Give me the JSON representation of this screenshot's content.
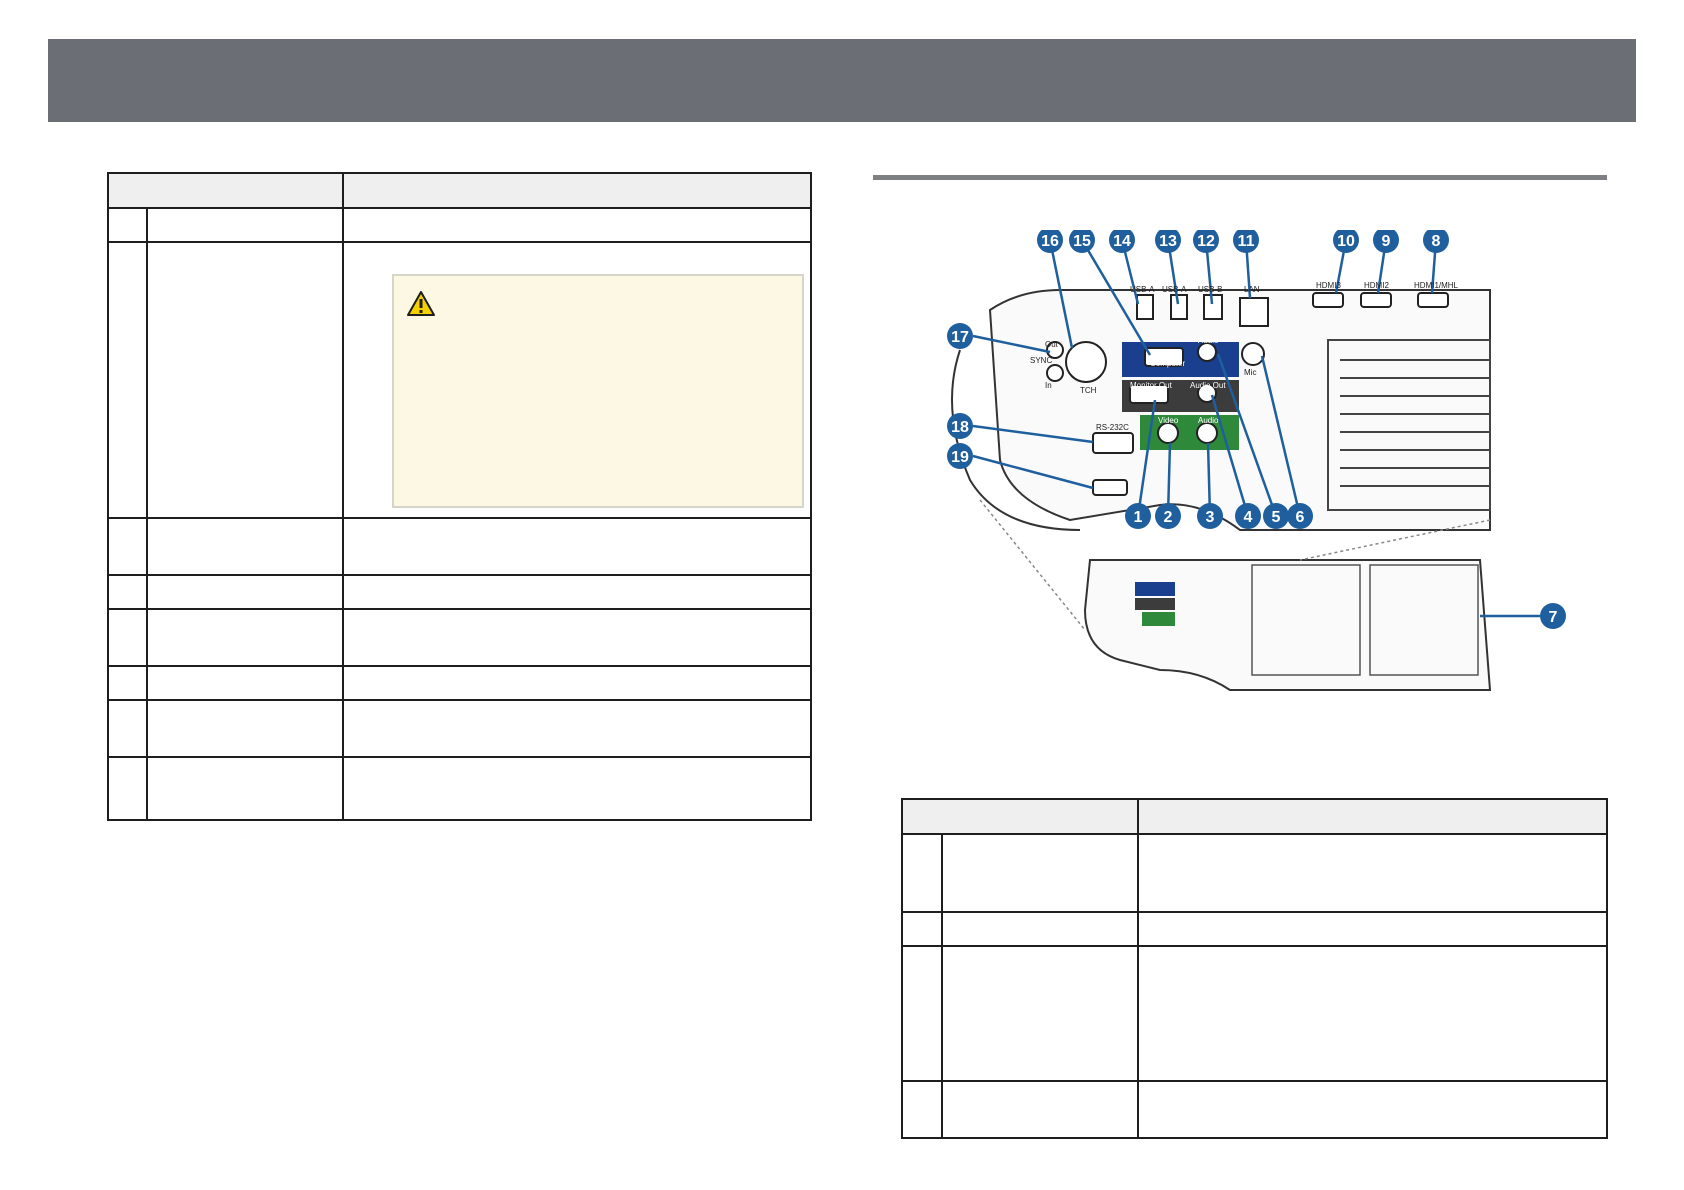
{
  "header": {
    "title": ""
  },
  "left_table": {
    "rows": 8
  },
  "right_table": {
    "rows": 4
  },
  "diagram": {
    "callouts": [
      "1",
      "2",
      "3",
      "4",
      "5",
      "6",
      "7",
      "8",
      "9",
      "10",
      "11",
      "12",
      "13",
      "14",
      "15",
      "16",
      "17",
      "18",
      "19"
    ],
    "port_labels": {
      "usb_a_1": "USB-A",
      "usb_a_2": "USB-A",
      "usb_b": "USB-B",
      "lan": "LAN",
      "hdmi3": "HDMI3",
      "hdmi2": "HDMI2",
      "hdmi1": "HDMI1/MHL",
      "computer": "Computer",
      "audio_top": "Audio",
      "mic": "Mic",
      "monitor_out": "Monitor Out",
      "audio_out": "Audio Out",
      "video": "Video",
      "audio_green": "Audio",
      "rs232c": "RS-232C",
      "tch": "TCH",
      "sync": "SYNC",
      "sync_out": "Out",
      "sync_in": "In"
    },
    "colors": {
      "blue_panel": "#1b3f8f",
      "green_panel": "#2e8a3a",
      "dark_panel": "#3c3c3c",
      "callout": "#1f5f9e"
    }
  }
}
